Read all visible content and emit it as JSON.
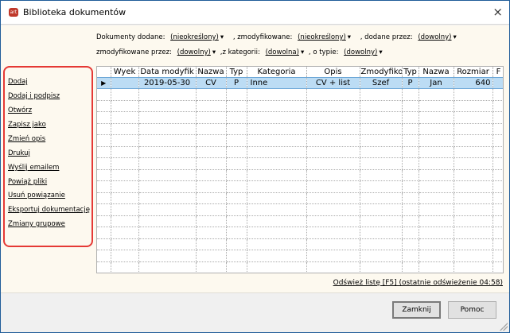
{
  "window": {
    "title": "Biblioteka dokumentów",
    "icon": "app-logo-icon",
    "close": "×"
  },
  "filters": {
    "added_label": "Dokumenty dodane:",
    "added_value": "(nieokreślony)",
    "modified_label": ", zmodyfikowane:",
    "modified_value": "(nieokreślony)",
    "added_by_label": ", dodane przez:",
    "added_by_value": "(dowolny)",
    "modified_by_label": "zmodyfikowane przez:",
    "modified_by_value": "(dowolny)",
    "category_label": ",z kategorii:",
    "category_value": "(dowolna)",
    "type_label": ", o typie:",
    "type_value": "(dowolny)"
  },
  "actions": [
    "Dodaj",
    "Dodaj i podpisz",
    "Otwórz",
    "Zapisz jako",
    "Zmień opis",
    "Drukuj",
    "Wyślij emailem",
    "Powiąż pliki",
    "Usuń powiązanie",
    "Eksportuj dokumentację",
    "Zmiany grupowe"
  ],
  "table": {
    "columns": [
      "",
      "Wyek",
      "Data modyfik",
      "Nazwa",
      "Typ",
      "Kategoria",
      "Opis",
      "Zmodyfiko",
      "Typ",
      "Nazwa",
      "Rozmiar",
      "F"
    ],
    "rows": [
      [
        "▶",
        "",
        "2019-05-30",
        "CV",
        "P",
        "Inne",
        "CV + list",
        "Szef",
        "P",
        "Jan",
        "640",
        ""
      ]
    ]
  },
  "refresh_link": "Odśwież listę [F5] (ostatnie odświeżenie 04:58)",
  "buttons": {
    "close": "Zamknij",
    "help": "Pomoc"
  },
  "colors": {
    "highlight": "#e53935",
    "selected_row": "#bcdcf4",
    "background": "#fdf9ef"
  }
}
